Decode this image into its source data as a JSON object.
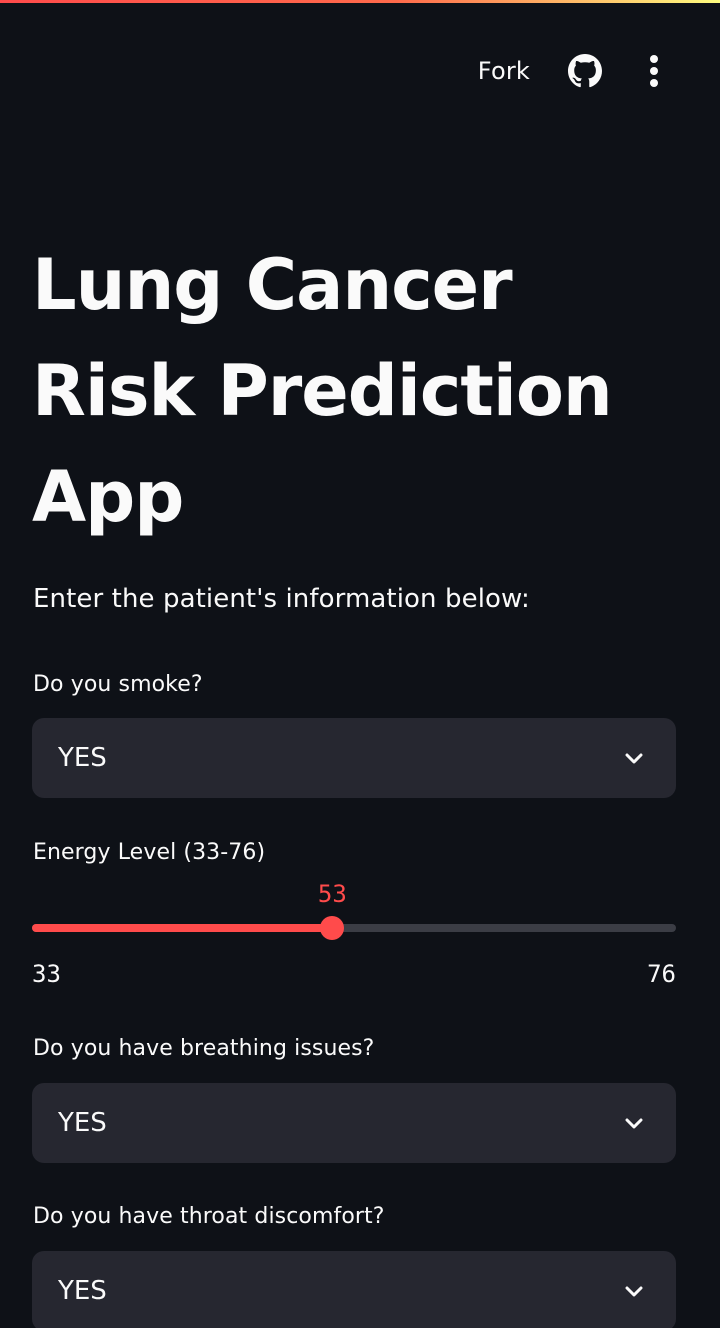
{
  "header": {
    "fork_label": "Fork",
    "github_icon": "github-icon",
    "menu_icon": "more-vertical-icon"
  },
  "title": "Lung Cancer Risk Prediction App",
  "subtitle": "Enter the patient's information below:",
  "fields": {
    "smoke": {
      "label": "Do you smoke?",
      "value": "YES"
    },
    "energy": {
      "label": "Energy Level (33-76)",
      "min": "33",
      "max": "76",
      "value": "53"
    },
    "breathing": {
      "label": "Do you have breathing issues?",
      "value": "YES"
    },
    "throat": {
      "label": "Do you have throat discomfort?",
      "value": "YES"
    }
  },
  "colors": {
    "background": "#0e1117",
    "input_bg": "#262730",
    "accent": "#ff4b4b",
    "text": "#fafafa"
  },
  "icons": {
    "dropdown": "chevron-down-icon"
  }
}
